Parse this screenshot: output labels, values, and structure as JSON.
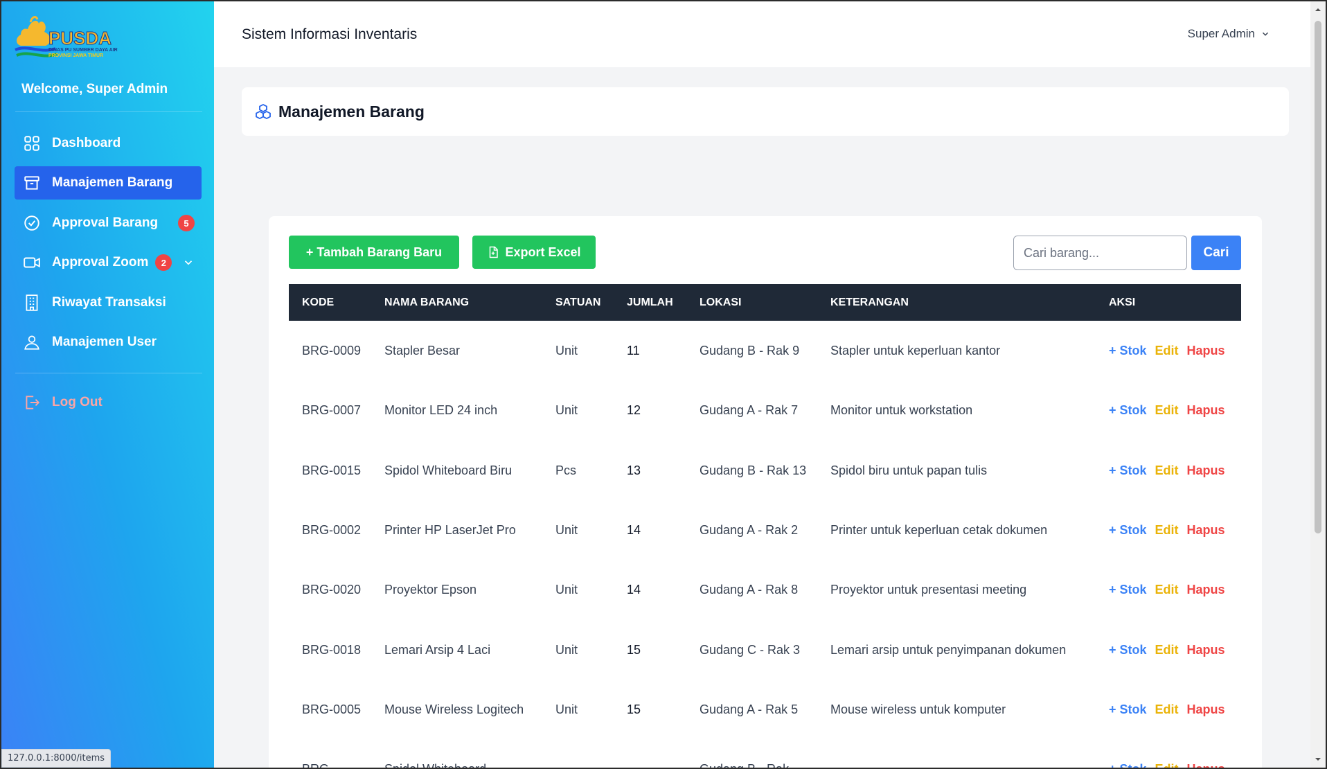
{
  "sidebar": {
    "logo_text": "PUSDA",
    "logo_sub1": "DINAS PU SUMBER DAYA AIR",
    "logo_sub2": "PROVINSI JAWA TIMUR",
    "welcome": "Welcome, Super Admin",
    "items": [
      {
        "label": "Dashboard",
        "icon": "grid-icon"
      },
      {
        "label": "Manajemen Barang",
        "icon": "archive-icon",
        "active": true
      },
      {
        "label": "Approval Barang",
        "icon": "check-circle-icon",
        "badge": "5"
      },
      {
        "label": "Approval Zoom",
        "icon": "video-icon",
        "badge": "2"
      },
      {
        "label": "Riwayat Transaksi",
        "icon": "building-icon"
      },
      {
        "label": "Manajemen User",
        "icon": "user-icon"
      }
    ],
    "logout": "Log Out"
  },
  "header": {
    "title": "Sistem Informasi Inventaris",
    "user": "Super Admin"
  },
  "page": {
    "title": "Manajemen Barang"
  },
  "toolbar": {
    "add_label": "+ Tambah Barang Baru",
    "export_label": "Export Excel",
    "search_placeholder": "Cari barang...",
    "search_button": "Cari"
  },
  "table": {
    "headers": [
      "KODE",
      "NAMA BARANG",
      "SATUAN",
      "JUMLAH",
      "LOKASI",
      "KETERANGAN",
      "AKSI"
    ],
    "action_labels": {
      "stok": "+ Stok",
      "edit": "Edit",
      "hapus": "Hapus"
    },
    "rows": [
      {
        "kode": "BRG-0009",
        "nama": "Stapler Besar",
        "satuan": "Unit",
        "jumlah": "11",
        "lokasi": "Gudang B - Rak 9",
        "keterangan": "Stapler untuk keperluan kantor"
      },
      {
        "kode": "BRG-0007",
        "nama": "Monitor LED 24 inch",
        "satuan": "Unit",
        "jumlah": "12",
        "lokasi": "Gudang A - Rak 7",
        "keterangan": "Monitor untuk workstation"
      },
      {
        "kode": "BRG-0015",
        "nama": "Spidol Whiteboard Biru",
        "satuan": "Pcs",
        "jumlah": "13",
        "lokasi": "Gudang B - Rak 13",
        "keterangan": "Spidol biru untuk papan tulis"
      },
      {
        "kode": "BRG-0002",
        "nama": "Printer HP LaserJet Pro",
        "satuan": "Unit",
        "jumlah": "14",
        "lokasi": "Gudang A - Rak 2",
        "keterangan": "Printer untuk keperluan cetak dokumen"
      },
      {
        "kode": "BRG-0020",
        "nama": "Proyektor Epson",
        "satuan": "Unit",
        "jumlah": "14",
        "lokasi": "Gudang A - Rak 8",
        "keterangan": "Proyektor untuk presentasi meeting"
      },
      {
        "kode": "BRG-0018",
        "nama": "Lemari Arsip 4 Laci",
        "satuan": "Unit",
        "jumlah": "15",
        "lokasi": "Gudang C - Rak 3",
        "keterangan": "Lemari arsip untuk penyimpanan dokumen"
      },
      {
        "kode": "BRG-0005",
        "nama": "Mouse Wireless Logitech",
        "satuan": "Unit",
        "jumlah": "15",
        "lokasi": "Gudang A - Rak 5",
        "keterangan": "Mouse wireless untuk komputer"
      },
      {
        "kode": "BRG-",
        "nama": "Spidol Whiteboard",
        "satuan": "",
        "jumlah": "",
        "lokasi": "Gudang B - Rak",
        "keterangan": ""
      }
    ]
  },
  "statusbar": {
    "url": "127.0.0.1:8000/items"
  },
  "colors": {
    "sidebar_start": "#3b82f6",
    "sidebar_end": "#22d3ee",
    "active_nav": "#2563eb",
    "green_button": "#22c55e",
    "blue_button": "#3b82f6",
    "table_header": "#1f2937",
    "stok": "#3b82f6",
    "edit": "#eab308",
    "hapus": "#ef4444"
  }
}
